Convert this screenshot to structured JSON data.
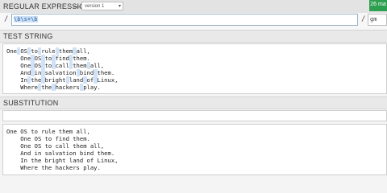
{
  "header": {
    "title": "REGULAR EXPRESSION",
    "dash": "—",
    "version_label": "version 1",
    "badge": "26 ma"
  },
  "regex": {
    "open_delim": "/",
    "pattern": "\\b\\s+\\b",
    "close_delim": "/",
    "flags": "gm"
  },
  "test_string": {
    "title": "TEST STRING",
    "lines": [
      "One OS to rule them all,",
      "    One OS to find them.",
      "    One OS to call them all,",
      "    And in salvation bind them.",
      "    In the bright land of Linux,",
      "    Where the hackers play."
    ]
  },
  "substitution": {
    "title": "SUBSTITUTION",
    "value": "",
    "result_lines": [
      "One OS to rule them all,",
      "    One OS to find them.",
      "    One OS to call them all,",
      "    And in salvation bind them.",
      "    In the bright land of Linux,",
      "    Where the hackers play."
    ]
  },
  "icons": {
    "dropdown": "chevron-down-icon"
  }
}
